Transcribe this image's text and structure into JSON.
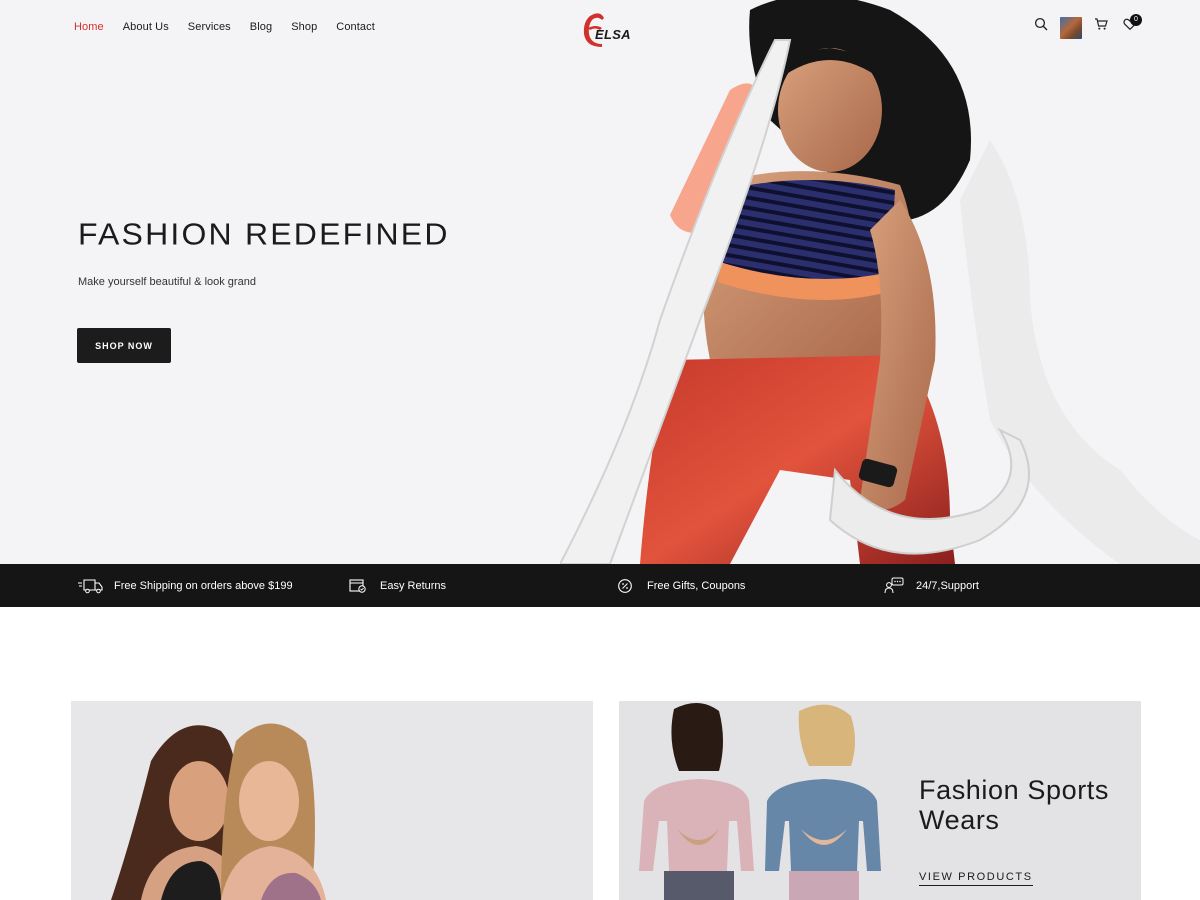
{
  "nav": {
    "items": [
      {
        "label": "Home",
        "active": true
      },
      {
        "label": "About Us"
      },
      {
        "label": "Services"
      },
      {
        "label": "Blog"
      },
      {
        "label": "Shop"
      },
      {
        "label": "Contact"
      }
    ]
  },
  "brand": {
    "name": "ELSA",
    "accent_color": "#d0312d"
  },
  "header_icons": {
    "search": "search-icon",
    "account": "avatar",
    "cart": "cart-icon",
    "wishlist": "heart-icon",
    "wishlist_count": "0"
  },
  "hero": {
    "title": "FASHION REDEFINED",
    "subtitle": "Make yourself beautiful & look grand",
    "cta_label": "SHOP NOW"
  },
  "features": [
    {
      "icon": "delivery-truck-icon",
      "label": "Free Shipping on orders above $199"
    },
    {
      "icon": "returns-icon",
      "label": "Easy Returns"
    },
    {
      "icon": "percent-icon",
      "label": "Free Gifts, Coupons"
    },
    {
      "icon": "support-icon",
      "label": "24/7,Support"
    }
  ],
  "promo": {
    "right": {
      "title_line1": "Fashion Sports",
      "title_line2": "Wears",
      "link_label": "VIEW PRODUCTS"
    }
  }
}
